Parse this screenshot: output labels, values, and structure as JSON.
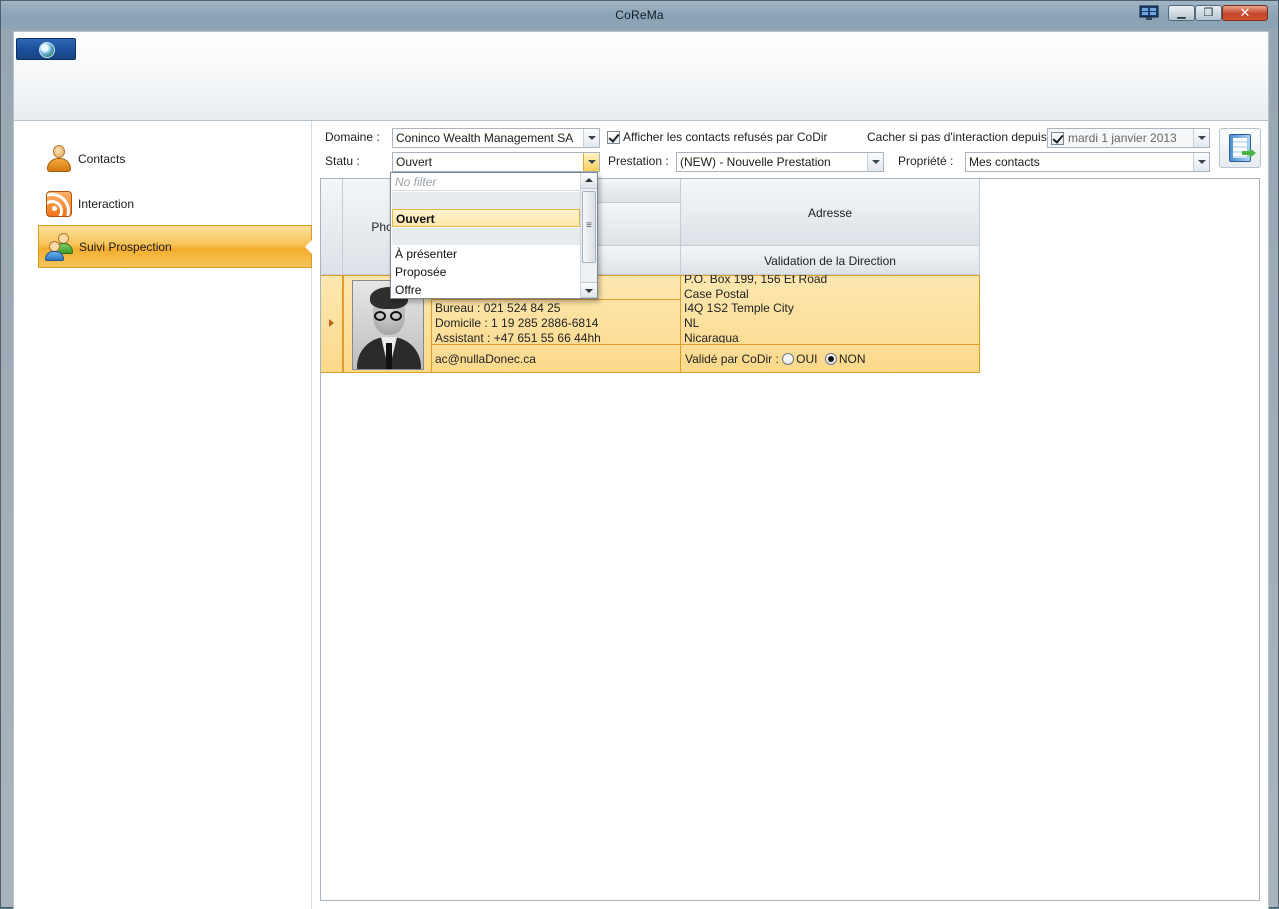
{
  "window": {
    "title": "CoReMa"
  },
  "sidebar": {
    "items": [
      {
        "label": "Contacts",
        "icon": "contact-person-icon",
        "active": false
      },
      {
        "label": "Interaction",
        "icon": "rss-feed-icon",
        "active": false
      },
      {
        "label": "Suivi Prospection",
        "icon": "people-group-icon",
        "active": true
      }
    ]
  },
  "filters": {
    "domaine_label": "Domaine :",
    "domaine_value": "Coninco Wealth Management SA",
    "afficher_refuses_label": "Afficher les contacts refusés par CoDir",
    "afficher_refuses_checked": true,
    "cacher_label": "Cacher si pas d'interaction depuis",
    "cacher_checked": true,
    "cacher_date": "mardi 1 janvier 2013",
    "statu_label": "Statu :",
    "statu_value": "Ouvert",
    "prestation_label": "Prestation :",
    "prestation_value": "(NEW) - Nouvelle Prestation",
    "propriete_label": "Propriété :",
    "propriete_value": "Mes contacts"
  },
  "statu_dropdown": {
    "placeholder": "No filter",
    "options": [
      "",
      "Ouvert",
      "",
      "À présenter",
      "Proposée",
      "Offre"
    ],
    "selected": "Ouvert"
  },
  "grid": {
    "headers": {
      "photo": "Photo",
      "adresse": "Adresse",
      "validation": "Validation de la Direction"
    },
    "row": {
      "bureau": "Bureau     : 021 524 84 25",
      "domicile": "Domicile   : 1 19 285 2886-6814",
      "assistant": "Assistant  : +47 651 55 66 44hh",
      "email": "ac@nullaDonec.ca",
      "address_lines": [
        "P.O. Box 199, 156 Et Road",
        "Case Postal",
        "I4Q 1S2 Temple City",
        "NL",
        "Nicaragua"
      ],
      "valide_label": "Validé par CoDir :",
      "oui_label": "OUI",
      "non_label": "NON",
      "validated": "NON"
    }
  },
  "colors": {
    "accent": "#f3ad2d",
    "selection": "#fbd98b",
    "border_accent": "#e39b2b"
  }
}
